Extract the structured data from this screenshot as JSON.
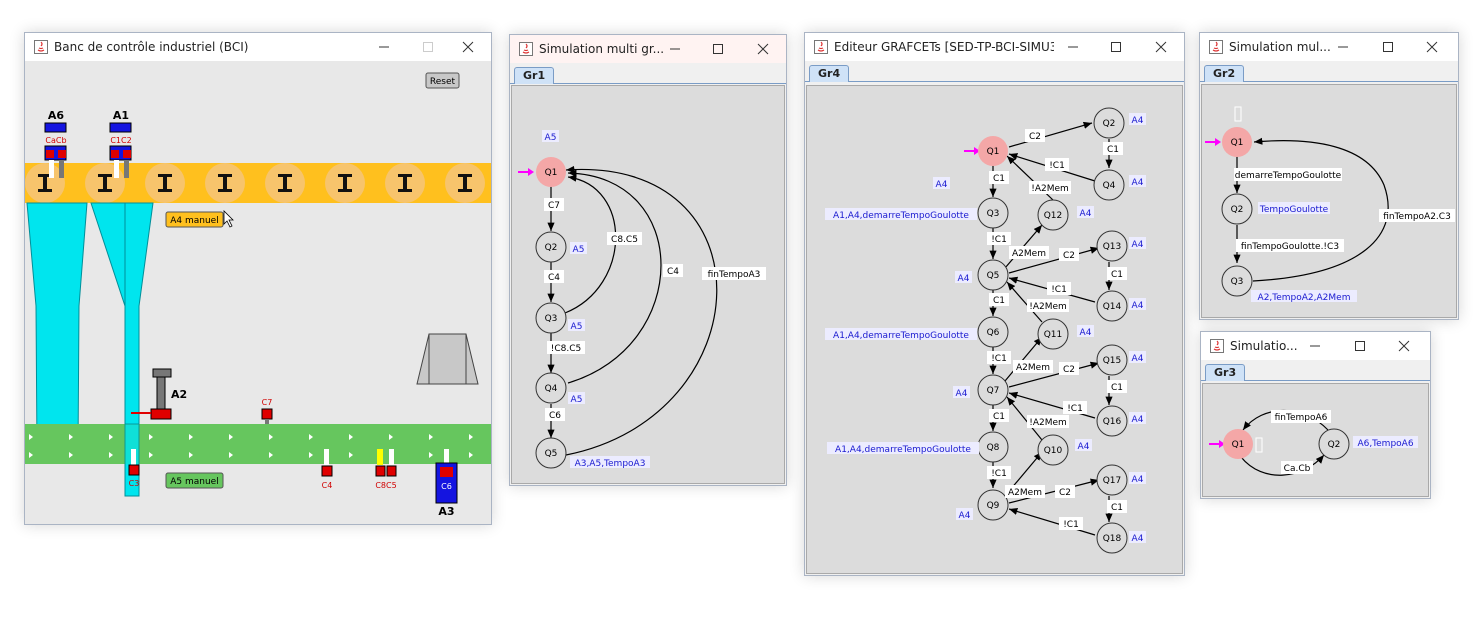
{
  "windows": {
    "bci": {
      "title": "Banc de contrôle industriel (BCI)",
      "reset_label": "Reset",
      "a4_button": "A4 manuel",
      "a5_button": "A5 manuel",
      "labels": {
        "a6": "A6",
        "a1": "A1",
        "cacb": "CaCb",
        "c1c2": "C1C2",
        "a2": "A2",
        "a3": "A3",
        "c7": "C7",
        "c3": "C3",
        "c4": "C4",
        "c8c5": "C8C5",
        "c6": "C6"
      }
    },
    "gr1": {
      "title": "Simulation multi gr...",
      "tab": "Gr1",
      "steps": {
        "q1": "Q1",
        "q2": "Q2",
        "q3": "Q3",
        "q4": "Q4",
        "q5": "Q5"
      },
      "actions": {
        "top": "A5",
        "q2": "A5",
        "q3": "A5",
        "q4": "A5",
        "q5": "A3,A5,TempoA3"
      },
      "transitions": {
        "t12": "C7",
        "t23": "C4",
        "t34": "!C8.C5",
        "t45": "C6",
        "t31": "C8.C5",
        "t41": "C4",
        "t51": "finTempoA3"
      }
    },
    "gr4": {
      "title": "Editeur GRAFCETs [SED-TP-BCI-SIMU3...",
      "tab": "Gr4",
      "steps": {
        "q1": "Q1",
        "q2": "Q2",
        "q3": "Q3",
        "q4": "Q4",
        "q5": "Q5",
        "q6": "Q6",
        "q7": "Q7",
        "q8": "Q8",
        "q9": "Q9",
        "q10": "Q10",
        "q11": "Q11",
        "q12": "Q12",
        "q13": "Q13",
        "q14": "Q14",
        "q15": "Q15",
        "q16": "Q16",
        "q17": "Q17",
        "q18": "Q18"
      },
      "actions": {
        "a4": "A4",
        "long": "A1,A4,demarreTempoGoulotte"
      },
      "transitions": {
        "c1": "C1",
        "c2": "C2",
        "nc1": "!C1",
        "a2mem": "A2Mem",
        "na2mem": "!A2Mem"
      }
    },
    "gr2": {
      "title": "Simulation mul...",
      "tab": "Gr2",
      "steps": {
        "q1": "Q1",
        "q2": "Q2",
        "q3": "Q3"
      },
      "actions": {
        "q2": "TempoGoulotte",
        "q3": "A2,TempoA2,A2Mem"
      },
      "transitions": {
        "t12": "demarreTempoGoulotte",
        "t23": "finTempoGoulotte.!C3",
        "t31": "finTempoA2.C3"
      }
    },
    "gr3": {
      "title": "Simulatio...",
      "tab": "Gr3",
      "steps": {
        "q1": "Q1",
        "q2": "Q2"
      },
      "actions": {
        "q2": "A6,TempoA6"
      },
      "transitions": {
        "t12": "Ca.Cb",
        "t21": "finTempoA6"
      }
    }
  },
  "icons": [
    "java-icon",
    "minimize-icon",
    "maximize-icon",
    "close-icon",
    "active-step-arrow-icon",
    "mouse-cursor-icon"
  ],
  "colors": {
    "accent": "#cfe2f7",
    "active_step": "#f4a7a7",
    "active_arrow": "#ff00ff",
    "action_text": "#1a1ad0",
    "conveyor": "#66c65e",
    "rail": "#ffc01e",
    "chute": "#00e5ee"
  }
}
